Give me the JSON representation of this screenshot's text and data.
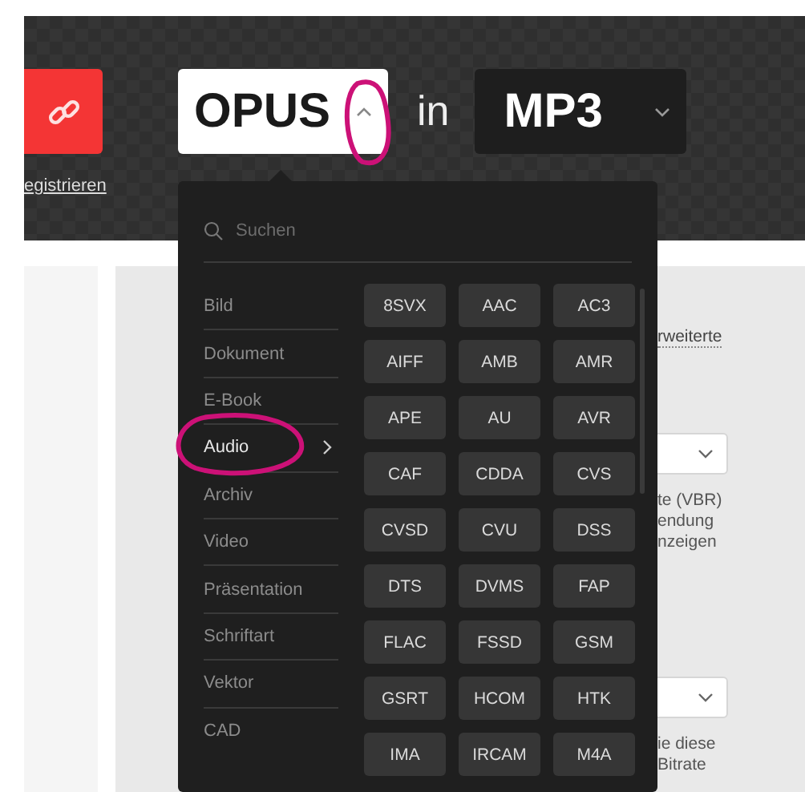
{
  "header": {
    "register_link": "egistrieren",
    "source_format": "OPUS",
    "source_open": true,
    "joiner": "in",
    "target_format": "MP3",
    "target_open": false
  },
  "dropdown": {
    "search": {
      "placeholder": "Suchen"
    },
    "categories": [
      {
        "label": "Bild",
        "selected": false
      },
      {
        "label": "Dokument",
        "selected": false
      },
      {
        "label": "E-Book",
        "selected": false
      },
      {
        "label": "Audio",
        "selected": true
      },
      {
        "label": "Archiv",
        "selected": false
      },
      {
        "label": "Video",
        "selected": false
      },
      {
        "label": "Präsentation",
        "selected": false
      },
      {
        "label": "Schriftart",
        "selected": false
      },
      {
        "label": "Vektor",
        "selected": false
      },
      {
        "label": "CAD",
        "selected": false
      }
    ],
    "formats": [
      "8SVX",
      "AAC",
      "AC3",
      "AIFF",
      "AMB",
      "AMR",
      "APE",
      "AU",
      "AVR",
      "CAF",
      "CDDA",
      "CVS",
      "CVSD",
      "CVU",
      "DSS",
      "DTS",
      "DVMS",
      "FAP",
      "FLAC",
      "FSSD",
      "GSM",
      "GSRT",
      "HCOM",
      "HTK",
      "IMA",
      "IRCAM",
      "M4A"
    ]
  },
  "settings": {
    "advanced_link": "rweiterte",
    "hint_1": [
      "te (VBR)",
      "endung",
      "nzeigen"
    ],
    "hint_2": [
      "ie diese",
      "Bitrate"
    ]
  }
}
